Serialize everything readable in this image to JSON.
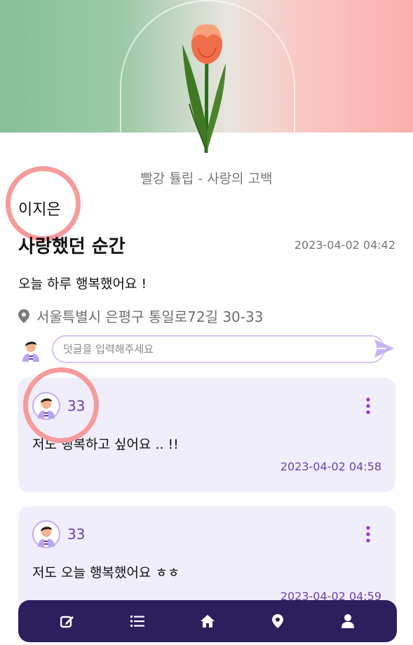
{
  "flower": {
    "caption": "빨강 튤립 - 사랑의 고백"
  },
  "post": {
    "author": "이지은",
    "title": "사랑했던 순간",
    "date": "2023-04-02 04:42",
    "body": "오늘 하루 행복했어요 !",
    "location": "서울특별시 은평구 통일로72길 30-33"
  },
  "comment_box": {
    "placeholder": "덧글을 입력해주세요",
    "value": ""
  },
  "comments": [
    {
      "user": "33",
      "text": "저도 행복하고 싶어요 .. !!",
      "date": "2023-04-02 04:58"
    },
    {
      "user": "33",
      "text": "저도 오늘 행복했어요 ㅎㅎ",
      "date": "2023-04-02 04:59"
    }
  ],
  "nav": {
    "icons": [
      "edit-icon",
      "list-icon",
      "home-icon",
      "location-icon",
      "user-icon"
    ]
  },
  "colors": {
    "accent": "#6b3fb5",
    "card_bg": "#f0eefb",
    "nav_bg": "#2d1f5e",
    "highlight_ring": "#f79a9a"
  }
}
